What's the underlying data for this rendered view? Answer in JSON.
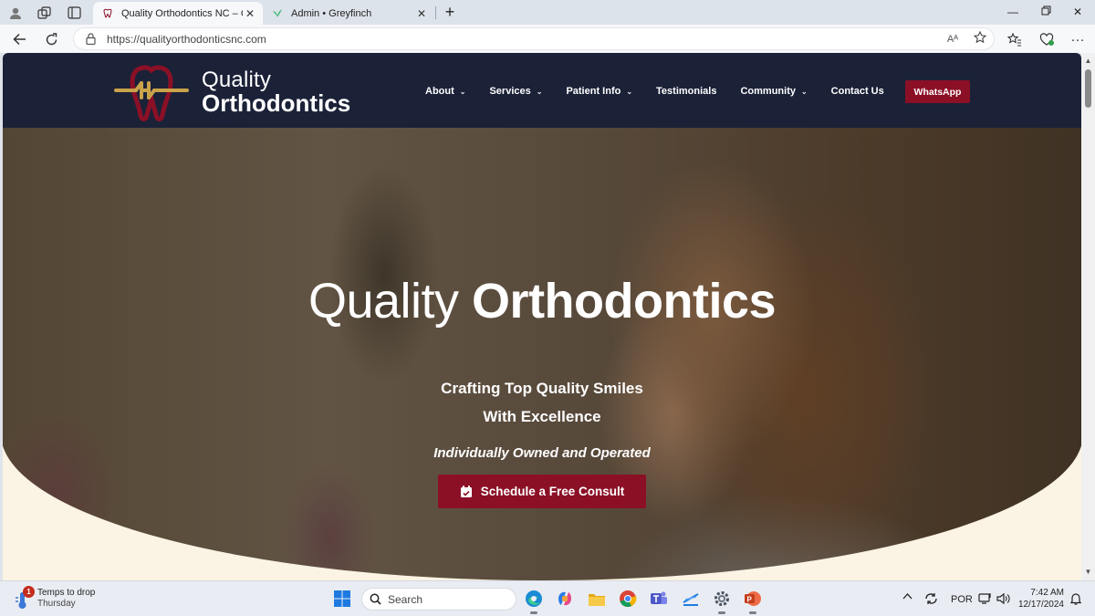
{
  "browser": {
    "tabs": [
      {
        "title": "Quality Orthodontics NC – Craftin",
        "active": true
      },
      {
        "title": "Admin • Greyfinch",
        "active": false
      }
    ],
    "url": "https://qualityorthodonticsnc.com",
    "read_aloud_label": "Aᴬ"
  },
  "site": {
    "logo": {
      "line1": "Quality",
      "line2": "Orthodontics"
    },
    "menu": [
      {
        "label": "About",
        "has_dropdown": true
      },
      {
        "label": "Services",
        "has_dropdown": true
      },
      {
        "label": "Patient Info",
        "has_dropdown": true
      },
      {
        "label": "Testimonials",
        "has_dropdown": false
      },
      {
        "label": "Community",
        "has_dropdown": true
      },
      {
        "label": "Contact Us",
        "has_dropdown": false
      }
    ],
    "whatsapp_label": "WhatsApp",
    "hero": {
      "title_light": "Quality",
      "title_bold": "Orthodontics",
      "subtitle_line1": "Crafting Top Quality Smiles",
      "subtitle_line2": "With Excellence",
      "tagline": "Individually Owned and Operated",
      "cta_label": "Schedule a Free Consult"
    },
    "colors": {
      "header": "#1b2238",
      "accent": "#8b1026",
      "gold": "#c9a24a"
    }
  },
  "taskbar": {
    "weather": {
      "badge": "1",
      "line1": "Temps to drop",
      "line2": "Thursday"
    },
    "search_placeholder": "Search",
    "apps": [
      "windows-start",
      "search",
      "edge",
      "copilot",
      "file-explorer",
      "chrome",
      "teams",
      "tool",
      "settings",
      "powerpoint"
    ],
    "language": "POR",
    "time": "7:42 AM",
    "date": "12/17/2024"
  }
}
